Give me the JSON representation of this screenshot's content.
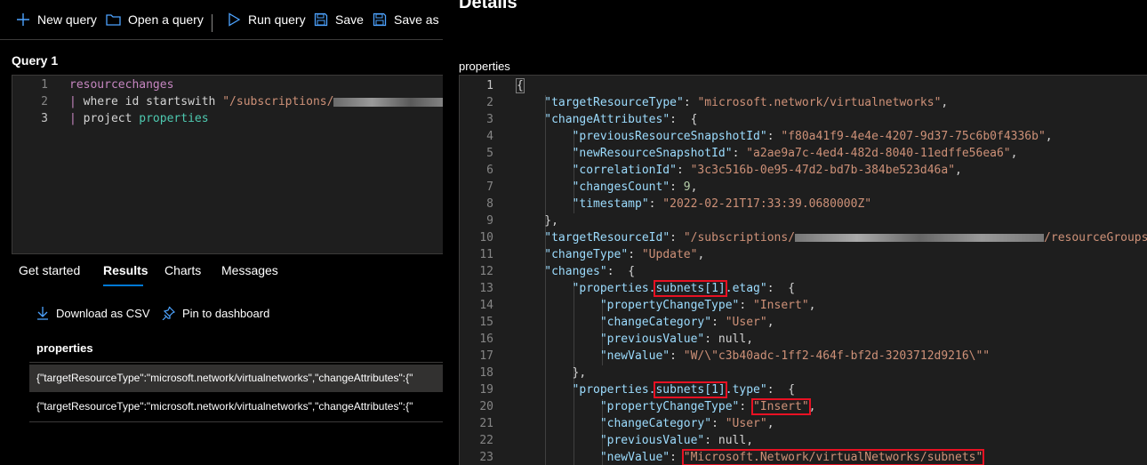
{
  "toolbar": {
    "new_query": "New query",
    "open_query": "Open a query",
    "run_query": "Run query",
    "save": "Save",
    "save_as": "Save as"
  },
  "query": {
    "title": "Query 1",
    "lines": [
      {
        "num": "1",
        "tokens": [
          "resourcechanges"
        ]
      },
      {
        "num": "2",
        "pipe": "|",
        "kw": "where",
        "field": "id",
        "op": "startswith",
        "str": "\"/subscriptions/"
      },
      {
        "num": "3",
        "pipe": "|",
        "kw": "project",
        "field": "properties"
      }
    ]
  },
  "results_tabs": [
    "Get started",
    "Results",
    "Charts",
    "Messages"
  ],
  "actions": {
    "download": "Download as CSV",
    "pin": "Pin to dashboard"
  },
  "results": {
    "header": "properties",
    "rows": [
      "{\"targetResourceType\":\"microsoft.network/virtualnetworks\",\"changeAttributes\":{\"",
      "{\"targetResourceType\":\"microsoft.network/virtualnetworks\",\"changeAttributes\":{\""
    ]
  },
  "details": {
    "title": "Details",
    "label": "properties",
    "json_lines": [
      {
        "n": "1",
        "t": "{"
      },
      {
        "n": "2",
        "k": "\"targetResourceType\"",
        "v": "\"microsoft.network/virtualnetworks\"",
        "e": ","
      },
      {
        "n": "3",
        "k": "\"changeAttributes\"",
        "e": " {"
      },
      {
        "n": "4",
        "k": "\"previousResourceSnapshotId\"",
        "v": "\"f80a41f9-4e4e-4207-9d37-75c6b0f4336b\"",
        "e": ","
      },
      {
        "n": "5",
        "k": "\"newResourceSnapshotId\"",
        "v": "\"a2ae9a7c-4ed4-482d-8040-11edffe56ea6\"",
        "e": ","
      },
      {
        "n": "6",
        "k": "\"correlationId\"",
        "v": "\"3c3c516b-0e95-47d2-bd7b-384be523d46a\"",
        "e": ","
      },
      {
        "n": "7",
        "k": "\"changesCount\"",
        "num": "9",
        "e": ","
      },
      {
        "n": "8",
        "k": "\"timestamp\"",
        "v": "\"2022-02-21T17:33:39.0680000Z\""
      },
      {
        "n": "9",
        "t": "},"
      },
      {
        "n": "10",
        "k": "\"targetResourceId\"",
        "v": "\"/subscriptions/",
        "v2": "/resourceGroups/"
      },
      {
        "n": "11",
        "k": "\"changeType\"",
        "v": "\"Update\"",
        "e": ","
      },
      {
        "n": "12",
        "k": "\"changes\"",
        "e": " {"
      },
      {
        "n": "13",
        "k1": "\"properties.",
        "kb": "subnets[1]",
        "k2": ".etag\"",
        "e": " {"
      },
      {
        "n": "14",
        "k": "\"propertyChangeType\"",
        "v": "\"Insert\"",
        "e": ","
      },
      {
        "n": "15",
        "k": "\"changeCategory\"",
        "v": "\"User\"",
        "e": ","
      },
      {
        "n": "16",
        "k": "\"previousValue\"",
        "lit": "null",
        "e": ","
      },
      {
        "n": "17",
        "k": "\"newValue\"",
        "v": "\"W/\\\"c3b40adc-1ff2-464f-bf2d-3203712d9216\\\"\""
      },
      {
        "n": "18",
        "t": "},"
      },
      {
        "n": "19",
        "k1": "\"properties.",
        "kb": "subnets[1]",
        "k2": ".type\"",
        "e": " {"
      },
      {
        "n": "20",
        "k": "\"propertyChangeType\"",
        "v": "\"Insert\"",
        "e": ","
      },
      {
        "n": "21",
        "k": "\"changeCategory\"",
        "v": "\"User\"",
        "e": ","
      },
      {
        "n": "22",
        "k": "\"previousValue\"",
        "lit": "null",
        "e": ","
      },
      {
        "n": "23",
        "k": "\"newValue\"",
        "v": "\"Microsoft.Network/virtualNetworks/subnets\""
      }
    ]
  }
}
